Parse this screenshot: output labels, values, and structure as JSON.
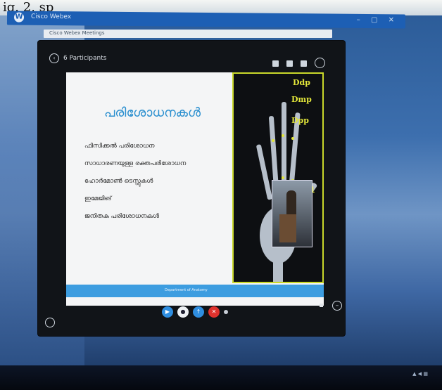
{
  "caption_fragment": "ig. 2, sp",
  "window": {
    "title": "Cisco Webex",
    "subtitle": "Cisco Webex Meetings"
  },
  "meeting": {
    "participants_label": "6 Participants"
  },
  "slide": {
    "title": "പരിശോധനകൾ",
    "items": [
      "ഫിസിക്കൽ പരിശോധന",
      "സാധാരണയുള്ള രക്തപരിശോധന",
      "ഹോർമോൺ ടെസ്റ്റുകൾ",
      "ഇമേജിങ്",
      "ജനിതക പരിശോധനകൾ"
    ],
    "footer_text": "Department of Anatomy",
    "xray_labels": [
      "Ddp",
      "Dmp",
      "Dpp",
      "m"
    ]
  },
  "controls": [
    "video-icon",
    "mute-icon",
    "share-icon",
    "end-call-icon",
    "more-icon"
  ]
}
